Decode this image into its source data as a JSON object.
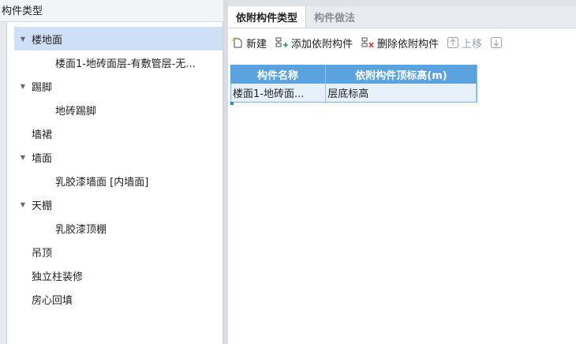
{
  "left": {
    "title": "构件类型",
    "tree": [
      {
        "label": "楼地面",
        "level": 0,
        "expanded": true,
        "selected": true
      },
      {
        "label": "楼面1-地砖面层-有敷管层-无...",
        "level": 1
      },
      {
        "label": "踢脚",
        "level": 0,
        "expanded": true
      },
      {
        "label": "地砖踢脚",
        "level": 1
      },
      {
        "label": "墙裙",
        "level": 0
      },
      {
        "label": "墙面",
        "level": 0,
        "expanded": true
      },
      {
        "label": "乳胶漆墙面 [内墙面]",
        "level": 1
      },
      {
        "label": "天棚",
        "level": 0,
        "expanded": true
      },
      {
        "label": "乳胶漆顶棚",
        "level": 1
      },
      {
        "label": "吊顶",
        "level": 0
      },
      {
        "label": "独立柱装修",
        "level": 0
      },
      {
        "label": "房心回填",
        "level": 0
      }
    ]
  },
  "right": {
    "tabs": [
      {
        "label": "依附构件类型",
        "active": true
      },
      {
        "label": "构件做法",
        "active": false
      }
    ],
    "toolbar": {
      "new_label": "新建",
      "add_label": "添加依附构件",
      "delete_label": "删除依附构件",
      "up_label": "上移",
      "down_label": ""
    },
    "grid": {
      "headers": [
        "构件名称",
        "依附构件顶标高(m)"
      ],
      "rows": [
        [
          "楼面1-地砖面...",
          "层底标高"
        ]
      ]
    }
  },
  "colors": {
    "selection": "#cfe0f6",
    "grid_header": "#5aa2e0",
    "grid_row": "#e6f1fc",
    "icon_green": "#2e9b57",
    "icon_red": "#d9342b",
    "icon_blue": "#2f7fd2"
  }
}
